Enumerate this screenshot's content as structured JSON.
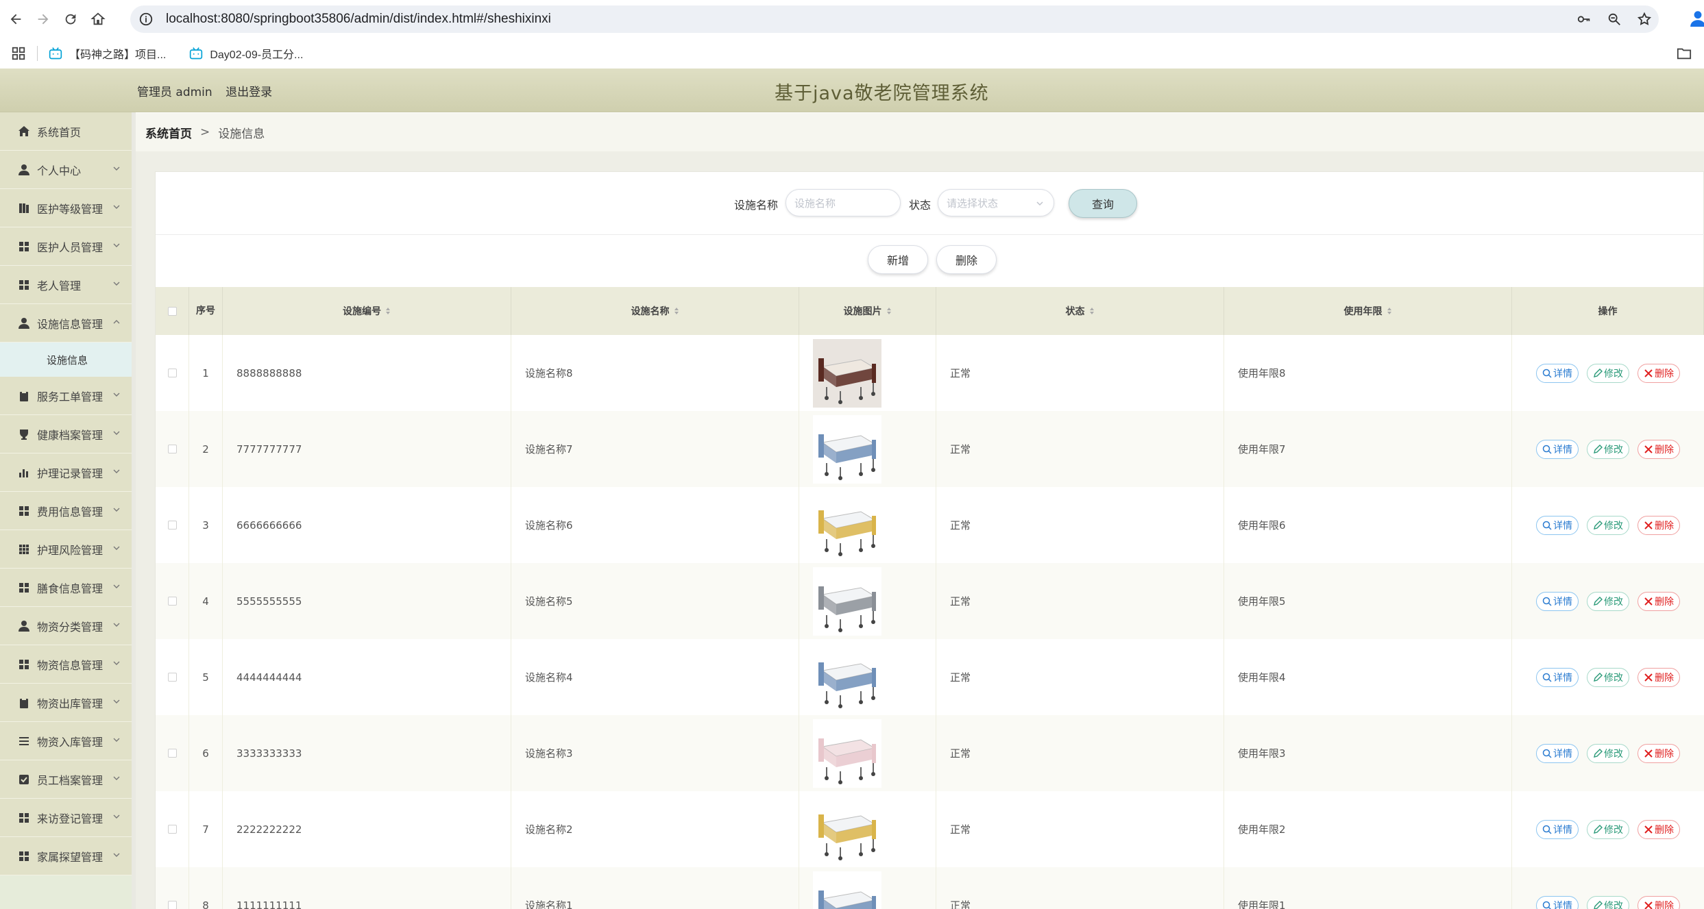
{
  "browser": {
    "url": "localhost:8080/springboot35806/admin/dist/index.html#/sheshixinxi",
    "bookmarks": [
      "【码神之路】项目...",
      "Day02-09-员工分..."
    ]
  },
  "header": {
    "role": "管理员 admin",
    "logout": "退出登录",
    "title": "基于java敬老院管理系统"
  },
  "sidebar": {
    "items": [
      {
        "label": "系统首页",
        "icon": "home-icon",
        "chevron": false
      },
      {
        "label": "个人中心",
        "icon": "user-icon",
        "chevron": true
      },
      {
        "label": "医护等级管理",
        "icon": "book-icon",
        "chevron": true
      },
      {
        "label": "医护人员管理",
        "icon": "grid-icon",
        "chevron": true
      },
      {
        "label": "老人管理",
        "icon": "grid-icon",
        "chevron": true
      },
      {
        "label": "设施信息管理",
        "icon": "user-icon",
        "chevron": true,
        "open": true
      },
      {
        "label": "服务工单管理",
        "icon": "clipboard-icon",
        "chevron": true
      },
      {
        "label": "健康档案管理",
        "icon": "trophy-icon",
        "chevron": true
      },
      {
        "label": "护理记录管理",
        "icon": "bar-chart-icon",
        "chevron": true
      },
      {
        "label": "费用信息管理",
        "icon": "grid-icon",
        "chevron": true
      },
      {
        "label": "护理风险管理",
        "icon": "dots-grid-icon",
        "chevron": true
      },
      {
        "label": "膳食信息管理",
        "icon": "grid-icon",
        "chevron": true
      },
      {
        "label": "物资分类管理",
        "icon": "user-icon",
        "chevron": true
      },
      {
        "label": "物资信息管理",
        "icon": "grid-icon",
        "chevron": true
      },
      {
        "label": "物资出库管理",
        "icon": "clipboard-icon",
        "chevron": true
      },
      {
        "label": "物资入库管理",
        "icon": "list-icon",
        "chevron": true
      },
      {
        "label": "员工档案管理",
        "icon": "check-square-icon",
        "chevron": true
      },
      {
        "label": "来访登记管理",
        "icon": "grid-icon",
        "chevron": true
      },
      {
        "label": "家属探望管理",
        "icon": "grid-icon",
        "chevron": true
      }
    ],
    "sub_item": "设施信息"
  },
  "breadcrumb": {
    "home": "系统首页",
    "separator": ">",
    "current": "设施信息"
  },
  "search": {
    "name_label": "设施名称",
    "name_placeholder": "设施名称",
    "status_label": "状态",
    "status_placeholder": "请选择状态",
    "query_button": "查询"
  },
  "actions": {
    "add": "新增",
    "delete": "删除"
  },
  "table": {
    "columns": {
      "index": "序号",
      "code": "设施编号",
      "name": "设施名称",
      "image": "设施图片",
      "status": "状态",
      "years": "使用年限",
      "ops": "操作"
    },
    "op_labels": {
      "detail": "详情",
      "edit": "修改",
      "delete": "删除"
    },
    "rows": [
      {
        "index": "1",
        "code": "8888888888",
        "name": "设施名称8",
        "status": "正常",
        "years": "使用年限8",
        "image": "bed-dark"
      },
      {
        "index": "2",
        "code": "7777777777",
        "name": "设施名称7",
        "status": "正常",
        "years": "使用年限7",
        "image": "bed-blue"
      },
      {
        "index": "3",
        "code": "6666666666",
        "name": "设施名称6",
        "status": "正常",
        "years": "使用年限6",
        "image": "bed-yellow"
      },
      {
        "index": "4",
        "code": "5555555555",
        "name": "设施名称5",
        "status": "正常",
        "years": "使用年限5",
        "image": "bed-grey"
      },
      {
        "index": "5",
        "code": "4444444444",
        "name": "设施名称4",
        "status": "正常",
        "years": "使用年限4",
        "image": "bed-blue"
      },
      {
        "index": "6",
        "code": "3333333333",
        "name": "设施名称3",
        "status": "正常",
        "years": "使用年限3",
        "image": "bed-pink"
      },
      {
        "index": "7",
        "code": "2222222222",
        "name": "设施名称2",
        "status": "正常",
        "years": "使用年限2",
        "image": "bed-yellow"
      },
      {
        "index": "8",
        "code": "1111111111",
        "name": "设施名称1",
        "status": "正常",
        "years": "使用年限1",
        "image": "bed-blue"
      }
    ]
  }
}
